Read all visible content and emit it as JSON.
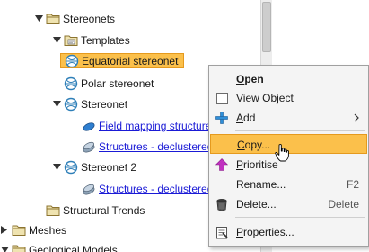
{
  "tree": {
    "items": [
      {
        "label": "Stereonets"
      },
      {
        "label": "Templates"
      },
      {
        "label": "Equatorial stereonet"
      },
      {
        "label": "Polar stereonet"
      },
      {
        "label": "Stereonet"
      },
      {
        "label": "Field mapping structures"
      },
      {
        "label": "Structures - declustered"
      },
      {
        "label": "Stereonet 2"
      },
      {
        "label": "Structures - declustered"
      },
      {
        "label": "Structural Trends"
      },
      {
        "label": "Meshes"
      },
      {
        "label": "Geological Models"
      }
    ]
  },
  "context_menu": {
    "items": [
      {
        "label": "Open",
        "mnemonic": "O",
        "rest": "pen",
        "shortcut": ""
      },
      {
        "label": "View Object",
        "mnemonic": "V",
        "rest": "iew Object",
        "shortcut": ""
      },
      {
        "label": "Add",
        "mnemonic": "A",
        "rest": "dd",
        "shortcut": ""
      },
      {
        "label": "Copy...",
        "mnemonic": "C",
        "rest": "opy...",
        "shortcut": ""
      },
      {
        "label": "Prioritise",
        "mnemonic": "P",
        "rest": "rioritise",
        "shortcut": ""
      },
      {
        "label": "Rename...",
        "mnemonic": "",
        "rest": "Rename...",
        "shortcut": "F2"
      },
      {
        "label": "Delete...",
        "mnemonic": "",
        "rest": "Delete...",
        "shortcut": "Delete"
      },
      {
        "label": "Properties...",
        "mnemonic": "P",
        "rest": "roperties...",
        "shortcut": ""
      }
    ]
  },
  "colors": {
    "selection": "#fbc04b",
    "selection_border": "#e59a1e",
    "link": "#1a1ad6",
    "stereonet_icon": "#2e7fb8",
    "folder": "#d8b85a",
    "prioritise_arrow": "#c030c0"
  }
}
